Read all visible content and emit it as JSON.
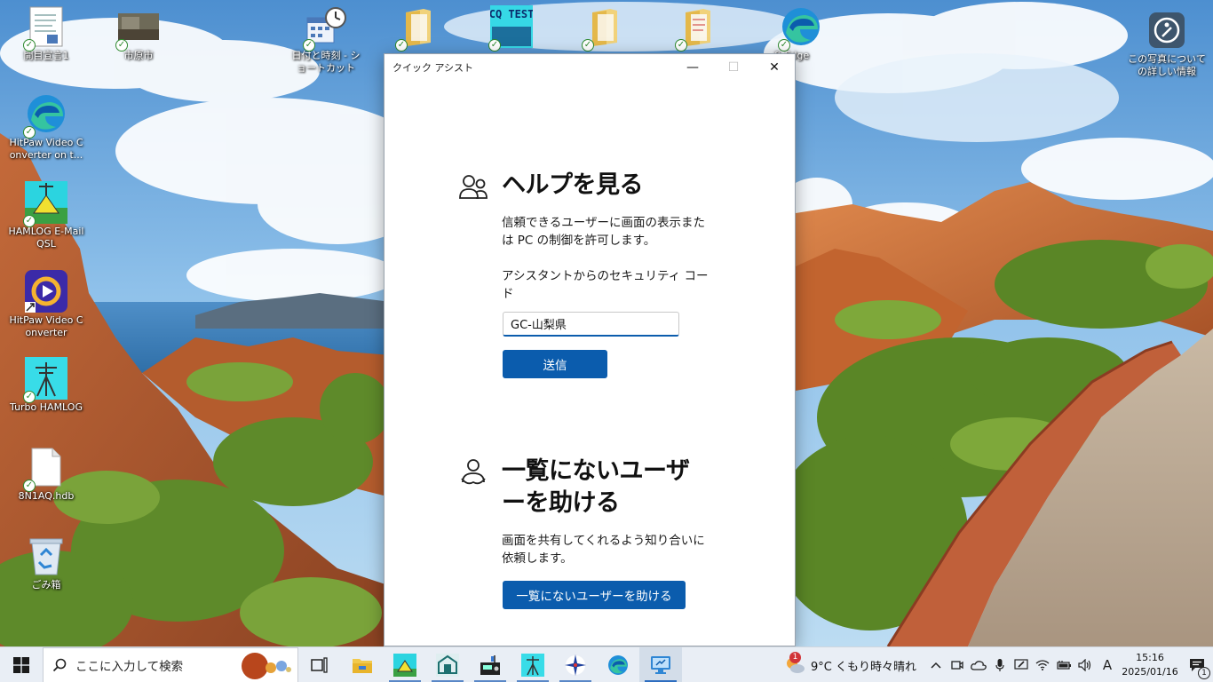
{
  "desktop": {
    "icons": [
      {
        "label": "開目宣言1",
        "icon": "document-icon"
      },
      {
        "label": "市原市",
        "icon": "photo-icon"
      },
      {
        "label": "日付と時刻 - ショートカット",
        "icon": "calendar-clock-icon"
      },
      {
        "label": "",
        "icon": "folder-icon"
      },
      {
        "label": "",
        "icon": "cq-test-icon",
        "art_text": "CQ TEST"
      },
      {
        "label": "",
        "icon": "folder-icon"
      },
      {
        "label": "",
        "icon": "folder-icon"
      },
      {
        "label": "ft Edge",
        "icon": "edge-icon"
      },
      {
        "label": "この写真についての詳しい情報",
        "icon": "info-icon"
      },
      {
        "label": "HitPaw Video Converter on t...",
        "icon": "edge-icon"
      },
      {
        "label": "HAMLOG E-Mail QSL",
        "icon": "hamlog-email-icon"
      },
      {
        "label": "HitPaw Video Converter",
        "icon": "hitpaw-icon"
      },
      {
        "label": "Turbo HAMLOG",
        "icon": "turbo-hamlog-icon"
      },
      {
        "label": "8N1AQ.hdb",
        "icon": "file-icon"
      },
      {
        "label": "ごみ箱",
        "icon": "recycle-bin-icon"
      }
    ]
  },
  "window": {
    "title": "クイック アシスト",
    "minimize_glyph": "—",
    "maximize_glyph": "☐",
    "close_glyph": "✕",
    "get_help": {
      "heading": "ヘルプを見る",
      "description_line1": "信頼できるユーザーに画面の表示また",
      "description_line2": "は PC の制御を許可します。",
      "code_label_line1": "アシスタントからのセキュリティ コー",
      "code_label_line2": "ド",
      "code_value": "GC-山梨県",
      "submit_label": "送信"
    },
    "help_someone": {
      "heading_line1": "一覧にないユーザ",
      "heading_line2": "ーを助ける",
      "description_line1": "画面を共有してくれるよう知り合いに",
      "description_line2": "依頼します。",
      "button_label": "一覧にないユーザーを助ける"
    }
  },
  "taskbar": {
    "search_placeholder": "ここに入力して検索",
    "apps": [
      "task-view-icon",
      "file-explorer-icon",
      "hamlog-icon",
      "ham-app-icon",
      "radio-app-icon",
      "antenna-app-icon",
      "compass-app-icon",
      "edge-icon",
      "quick-assist-icon"
    ],
    "weather": {
      "badge": "1",
      "text": "9°C くもり時々晴れ"
    },
    "ime": "A",
    "time": "15:16",
    "date": "2025/01/16",
    "notification_count": "1"
  },
  "colors": {
    "accent": "#0b5cad",
    "taskbar": "#e9eef5",
    "sync_green": "#2f8a2f"
  }
}
